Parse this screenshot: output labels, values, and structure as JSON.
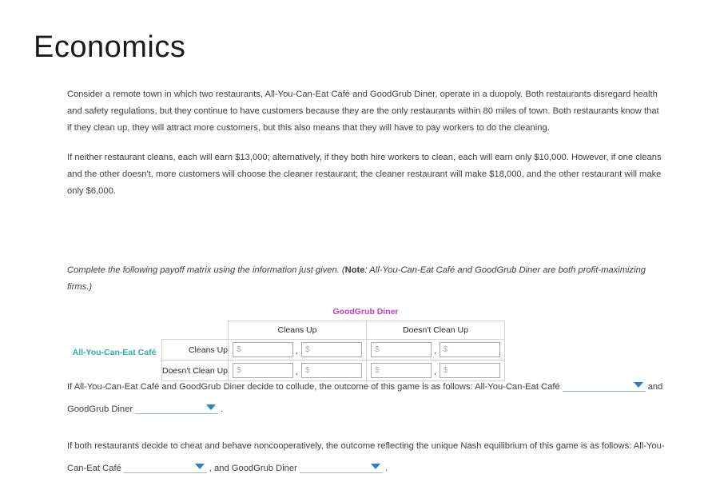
{
  "page": {
    "title": "Economics"
  },
  "paragraphs": {
    "p1": "Consider a remote town in which two restaurants, All-You-Can-Eat Café and GoodGrub Diner, operate in a duopoly. Both restaurants disregard health and safety regulations, but they continue to have customers because they are the only restaurants within 80 miles of town. Both restaurants know that if they clean up, they will attract more customers, but this also means that they will have to pay workers to do the cleaning.",
    "p2": "If neither restaurant cleans, each will earn $13,000; alternatively, if they both hire workers to clean, each will earn only $10,000. However, if one cleans and the other doesn't, more customers will choose the cleaner restaurant; the cleaner restaurant will make $18,000, and the other restaurant will make only $6,000."
  },
  "instruction": {
    "lead": "Complete the following payoff matrix using the information just given. (",
    "note_label": "Note",
    "note_text": ": All-You-Can-Eat Café and GoodGrub Diner are both profit-maximizing firms.)"
  },
  "matrix": {
    "column_player": "GoodGrub Diner",
    "row_player": "All-You-Can-Eat Café",
    "column_player_color": "#c63fc0",
    "row_player_color": "#2eaead",
    "column_headers": [
      "Cleans Up",
      "Doesn't Clean Up"
    ],
    "row_headers": [
      "Cleans Up",
      "Doesn't Clean Up"
    ],
    "cell_separator": ",",
    "input_placeholder": "$",
    "cells": [
      [
        {
          "left": "",
          "right": ""
        },
        {
          "left": "",
          "right": ""
        }
      ],
      [
        {
          "left": "",
          "right": ""
        },
        {
          "left": "",
          "right": ""
        }
      ]
    ]
  },
  "questions": {
    "q1": {
      "seg1": "If All-You-Can-Eat Café and GoodGrub Diner decide to collude, the outcome of this game is as follows: All-You-Can-Eat Café",
      "dropdown1_value": "",
      "seg2": "and GoodGrub Diner",
      "dropdown2_value": "",
      "seg3": "."
    },
    "q2": {
      "seg1": "If both restaurants decide to cheat and behave noncooperatively, the outcome reflecting the unique Nash equilibrium of this game is as follows: All-You-Can-Eat Café",
      "dropdown1_value": "",
      "seg2": ", and GoodGrub Diner",
      "dropdown2_value": "",
      "seg3": "."
    }
  },
  "colors": {
    "accent_blue": "#2f7fc1",
    "underline_blue": "#8fb8dd",
    "input_border": "#a9a9a9",
    "table_border": "#d2d2d2"
  }
}
